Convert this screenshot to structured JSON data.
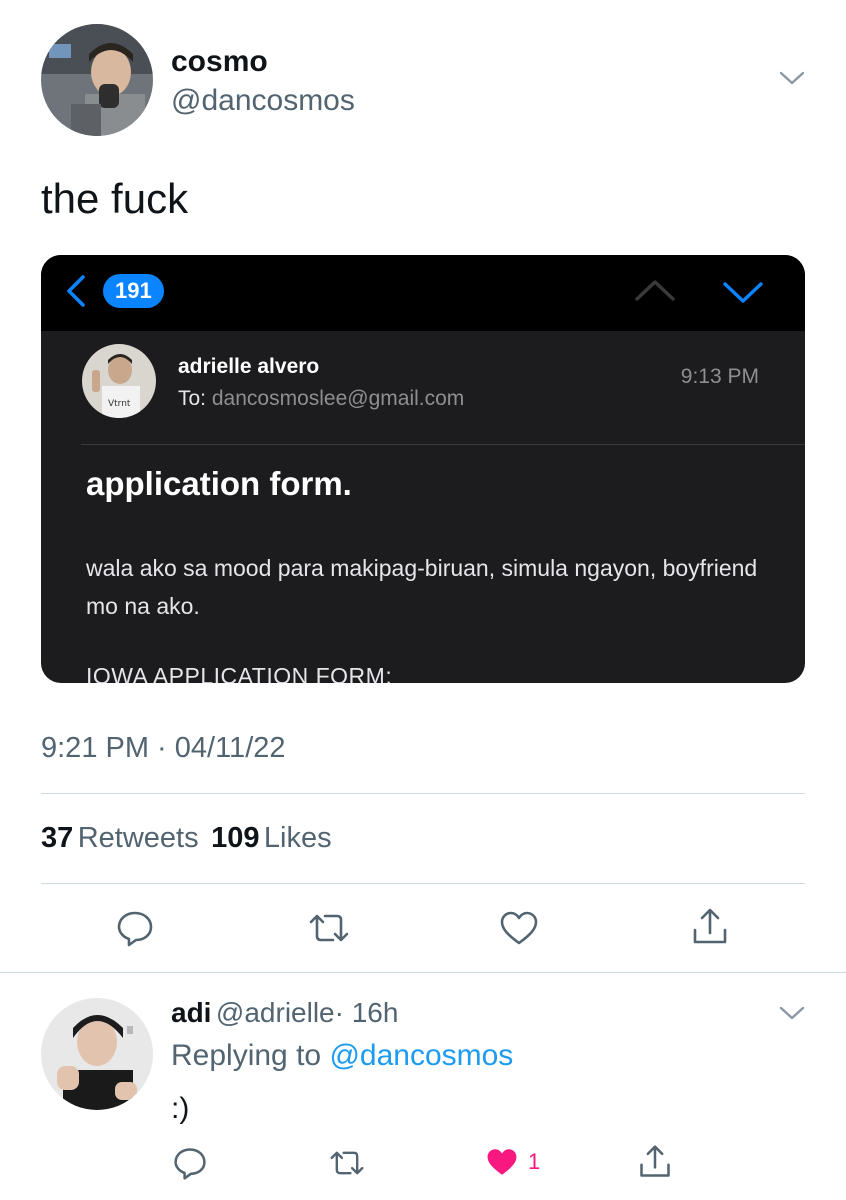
{
  "tweet": {
    "author_name": "cosmo",
    "author_handle": "@dancosmos",
    "text": "the fuck",
    "timestamp": "9:21 PM · 04/11/22",
    "retweets_count": "37",
    "retweets_label": "Retweets",
    "likes_count": "109",
    "likes_label": "Likes"
  },
  "email_card": {
    "unread_badge": "191",
    "sender": "adrielle alvero",
    "to_label": "To:",
    "to_address": "dancosmoslee@gmail.com",
    "time": "9:13 PM",
    "subject": "application form.",
    "body": "wala ako sa mood para makipag-biruan, simula ngayon, boyfriend mo na ako.",
    "cut_line": "IOWA APPLICATION FORM:"
  },
  "reply": {
    "author_name": "adi",
    "author_handle": "@adrielle",
    "age": "· 16h",
    "replying_label": "Replying to",
    "replying_handle": "@dancosmos",
    "text": ":)",
    "like_count": "1"
  },
  "icons": {
    "more": "chevron-down-icon",
    "reply": "comment-icon",
    "retweet": "retweet-icon",
    "like": "heart-icon",
    "share": "share-icon",
    "back": "chevron-left-icon",
    "prev": "chevron-up-icon",
    "next": "chevron-down-icon"
  },
  "colors": {
    "link": "#1d9bf0",
    "like": "#f91880",
    "mail_accent": "#0a84ff",
    "secondary_text": "#536471"
  }
}
